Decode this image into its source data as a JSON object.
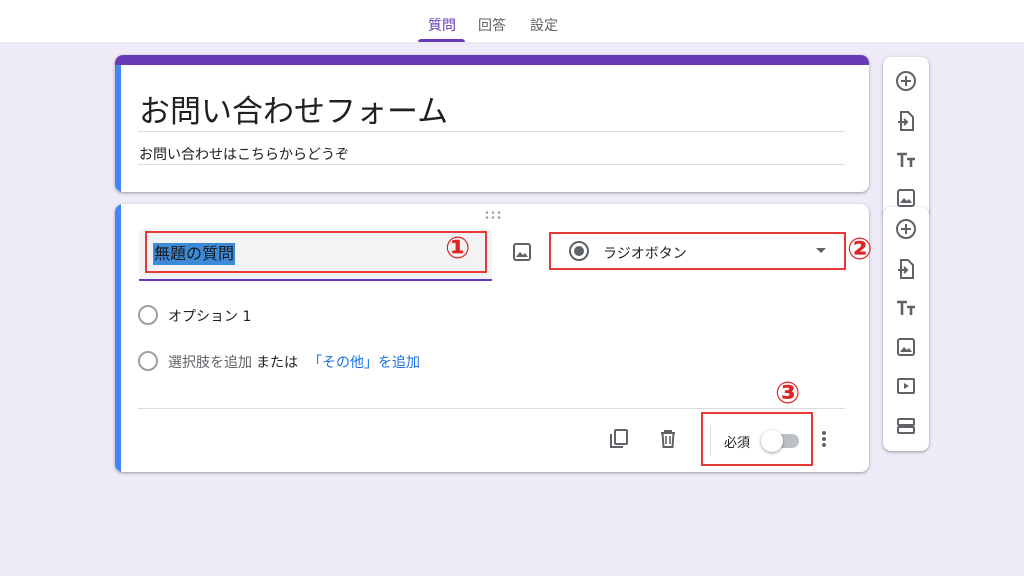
{
  "tabs": [
    {
      "label": "質問",
      "active": true
    },
    {
      "label": "回答",
      "active": false
    },
    {
      "label": "設定",
      "active": false
    }
  ],
  "form": {
    "title": "お問い合わせフォーム",
    "description": "お問い合わせはこちらからどうぞ"
  },
  "question": {
    "title": "無題の質問",
    "type": "ラジオボタン",
    "options": [
      "オプション 1"
    ],
    "add_option": "選択肢を追加",
    "or_text": "または",
    "add_other": "「その他」を追加",
    "required_label": "必須",
    "required": false
  },
  "annotations": [
    "①",
    "②",
    "③"
  ],
  "side_toolbar_icons": [
    "add-question-icon",
    "import-questions-icon",
    "add-title-icon",
    "add-image-icon",
    "add-video-icon",
    "add-section-icon"
  ],
  "colors": {
    "accent": "#673ab7",
    "focus": "#4285f4",
    "annotation": "#e53935",
    "background": "#f0ebf8"
  }
}
